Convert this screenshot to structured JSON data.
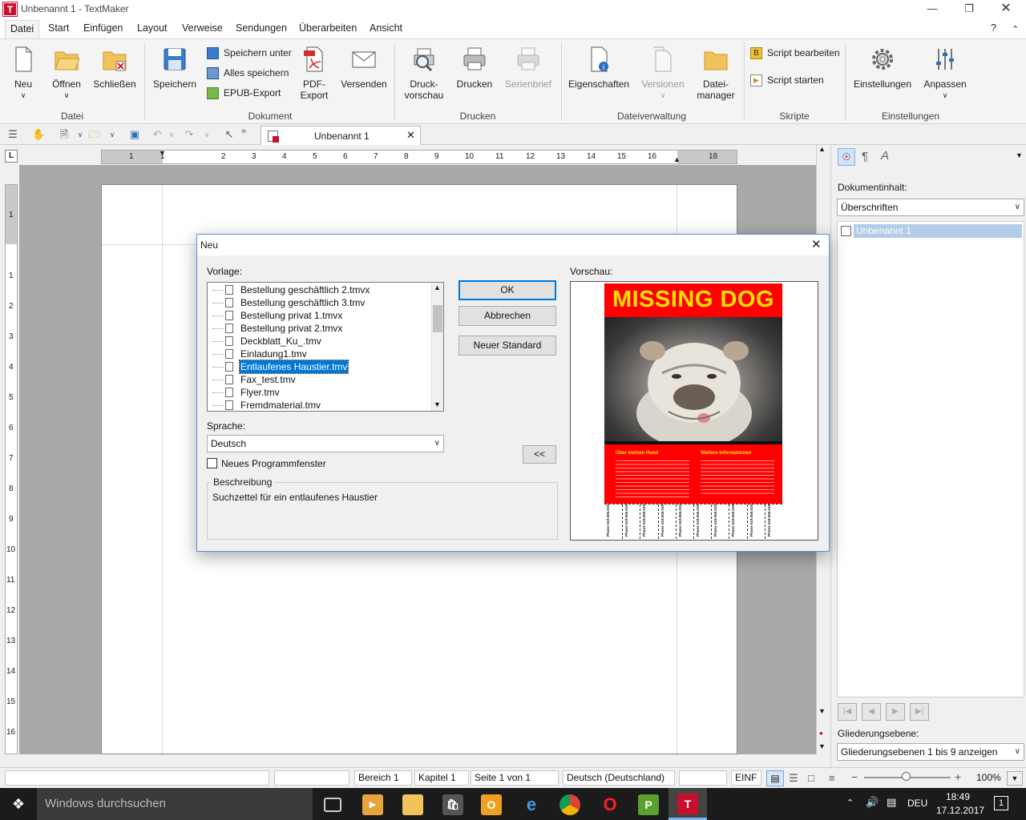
{
  "window": {
    "title": "Unbenannt 1 - TextMaker",
    "app_icon": "T",
    "help": "?"
  },
  "menu": [
    {
      "label": "Datei"
    },
    {
      "label": "Start"
    },
    {
      "label": "Einfügen"
    },
    {
      "label": "Layout"
    },
    {
      "label": "Verweise"
    },
    {
      "label": "Sendungen"
    },
    {
      "label": "Überarbeiten"
    },
    {
      "label": "Ansicht"
    }
  ],
  "ribbon": {
    "neu": "Neu",
    "oeffnen": "Öffnen",
    "schliessen": "Schließen",
    "group_datei": "Datei",
    "speichern": "Speichern",
    "speichern_unter": "Speichern unter",
    "alles_speichern": "Alles speichern",
    "epub": "EPUB-Export",
    "pdf1": "PDF-",
    "pdf2": "Export",
    "versenden": "Versenden",
    "group_dokument": "Dokument",
    "druck1": "Druck-",
    "druck2": "vorschau",
    "drucken": "Drucken",
    "serienbrief": "Serienbrief",
    "group_drucken": "Drucken",
    "eigenschaften": "Eigenschaften",
    "versionen": "Versionen",
    "dateimanager1": "Datei-",
    "dateimanager2": "manager",
    "group_dateiverwaltung": "Dateiverwaltung",
    "script_bearbeiten": "Script bearbeiten",
    "script_starten": "Script starten",
    "group_skripte": "Skripte",
    "einstellungen": "Einstellungen",
    "anpassen": "Anpassen",
    "group_einstellungen": "Einstellungen"
  },
  "doc_tab": {
    "label": "Unbenannt 1"
  },
  "ruler": {
    "h_numbers": [
      "1",
      "1",
      "2",
      "3",
      "4",
      "5",
      "6",
      "7",
      "8",
      "9",
      "10",
      "11",
      "12",
      "13",
      "14",
      "15",
      "16",
      "18"
    ],
    "v_numbers": [
      "1",
      "1",
      "2",
      "3",
      "4",
      "5",
      "6",
      "7",
      "8",
      "9",
      "10",
      "11",
      "12",
      "13",
      "14",
      "15",
      "16"
    ]
  },
  "right_panel": {
    "label": "Dokumentinhalt:",
    "combo": "Überschriften",
    "tree_item": "Unbenannt 1",
    "gliederung_label": "Gliederungsebene:",
    "gliederung_combo": "Gliederungsebenen 1 bis 9 anzeigen"
  },
  "status": {
    "bereich": "Bereich 1",
    "kapitel": "Kapitel 1",
    "seite": "Seite 1 von 1",
    "sprache": "Deutsch (Deutschland)",
    "mode": "EINF",
    "zoom": "100%"
  },
  "taskbar": {
    "search": "Windows durchsuchen",
    "time": "18:49",
    "date": "17.12.2017",
    "lang": "DEU",
    "notif": "1"
  },
  "dialog": {
    "title": "Neu",
    "vorlage_label": "Vorlage:",
    "templates": [
      {
        "name": "Bestellung geschäftlich 2.tmvx",
        "selected": false
      },
      {
        "name": "Bestellung geschäftlich 3.tmv",
        "selected": false
      },
      {
        "name": "Bestellung privat 1.tmvx",
        "selected": false
      },
      {
        "name": "Bestellung privat 2.tmvx",
        "selected": false
      },
      {
        "name": "Deckblatt_Ku_.tmv",
        "selected": false
      },
      {
        "name": "Einladung1.tmv",
        "selected": false
      },
      {
        "name": "Entlaufenes Haustier.tmv",
        "selected": true
      },
      {
        "name": "Fax_test.tmv",
        "selected": false
      },
      {
        "name": "Flyer.tmv",
        "selected": false
      },
      {
        "name": "Fremdmaterial.tmv",
        "selected": false
      }
    ],
    "ok": "OK",
    "abbrechen": "Abbrechen",
    "neuer_standard": "Neuer Standard",
    "sprache_label": "Sprache:",
    "sprache_value": "Deutsch",
    "neues_fenster": "Neues Programmfenster",
    "collapse": "<<",
    "beschreibung_label": "Beschreibung",
    "beschreibung_text": "Suchzettel für ein entlaufenes Haustier",
    "vorschau_label": "Vorschau:",
    "preview": {
      "headline": "MISSING DOG",
      "col1_title": "Über meinen Hund",
      "col2_title": "Weitere Informationen",
      "tab_text": "Phone 619.555.0191",
      "tabs": 10,
      "accent": "#ff0000",
      "headline_color": "#ffe000"
    }
  }
}
